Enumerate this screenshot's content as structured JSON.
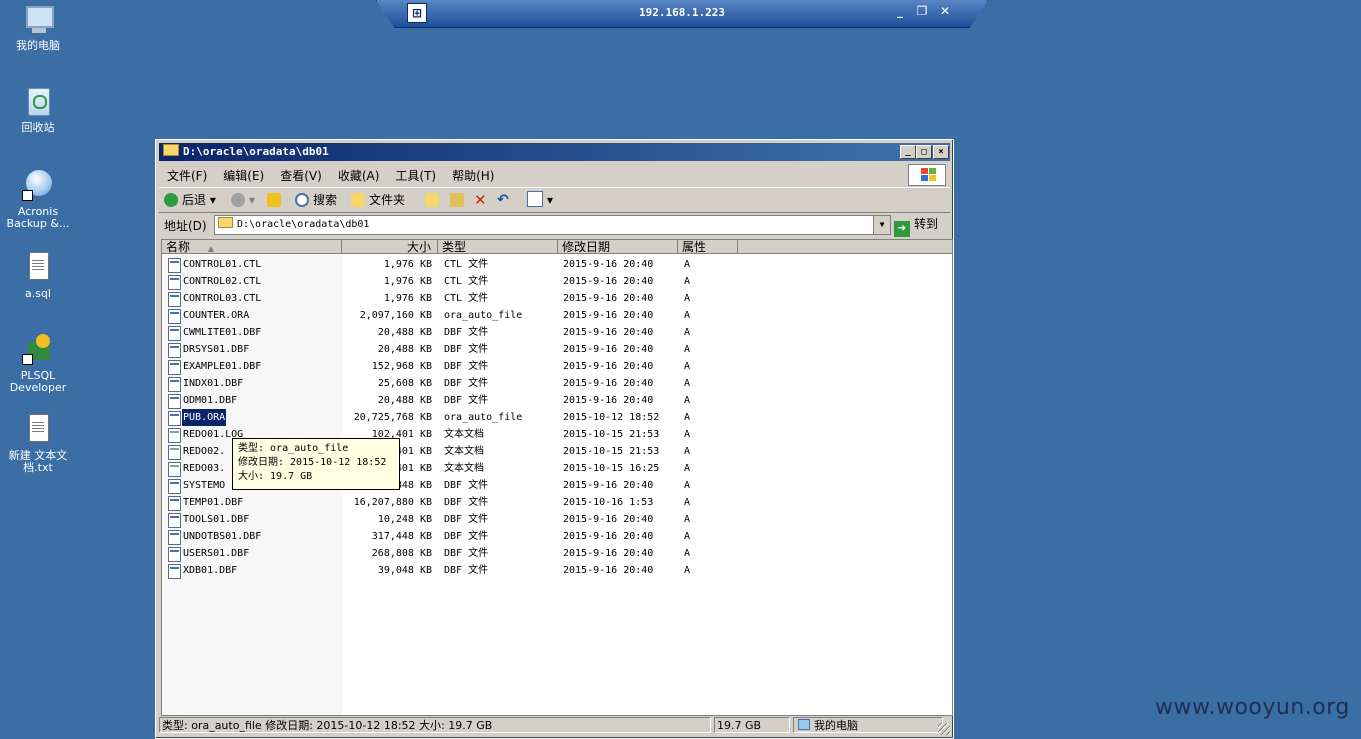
{
  "rdp": {
    "title": "192.168.1.223",
    "pin": "⊞",
    "min": "_",
    "restore": "❐",
    "close": "✕"
  },
  "desktop_icons": [
    {
      "label": "我的电脑"
    },
    {
      "label": "回收站"
    },
    {
      "label": "Acronis Backup &..."
    },
    {
      "label": "a.sql"
    },
    {
      "label": "PLSQL Developer"
    },
    {
      "label": "新建 文本文档.txt"
    }
  ],
  "window": {
    "title": "D:\\oracle\\oradata\\db01",
    "menu": [
      "文件(F)",
      "编辑(E)",
      "查看(V)",
      "收藏(A)",
      "工具(T)",
      "帮助(H)"
    ],
    "toolbar": {
      "back": "后退",
      "search": "搜索",
      "folders": "文件夹"
    },
    "address_label": "地址(D)",
    "address_value": "D:\\oracle\\oradata\\db01",
    "go_label": "转到",
    "columns": {
      "name": "名称",
      "size": "大小",
      "type": "类型",
      "date": "修改日期",
      "attr": "属性"
    },
    "files": [
      {
        "name": "CONTROL01.CTL",
        "size": "1,976 KB",
        "type": "CTL 文件",
        "date": "2015-9-16 20:40",
        "attr": "A"
      },
      {
        "name": "CONTROL02.CTL",
        "size": "1,976 KB",
        "type": "CTL 文件",
        "date": "2015-9-16 20:40",
        "attr": "A"
      },
      {
        "name": "CONTROL03.CTL",
        "size": "1,976 KB",
        "type": "CTL 文件",
        "date": "2015-9-16 20:40",
        "attr": "A"
      },
      {
        "name": "COUNTER.ORA",
        "size": "2,097,160 KB",
        "type": "ora_auto_file",
        "date": "2015-9-16 20:40",
        "attr": "A"
      },
      {
        "name": "CWMLITE01.DBF",
        "size": "20,488 KB",
        "type": "DBF 文件",
        "date": "2015-9-16 20:40",
        "attr": "A"
      },
      {
        "name": "DRSYS01.DBF",
        "size": "20,488 KB",
        "type": "DBF 文件",
        "date": "2015-9-16 20:40",
        "attr": "A"
      },
      {
        "name": "EXAMPLE01.DBF",
        "size": "152,968 KB",
        "type": "DBF 文件",
        "date": "2015-9-16 20:40",
        "attr": "A"
      },
      {
        "name": "INDX01.DBF",
        "size": "25,608 KB",
        "type": "DBF 文件",
        "date": "2015-9-16 20:40",
        "attr": "A"
      },
      {
        "name": "ODM01.DBF",
        "size": "20,488 KB",
        "type": "DBF 文件",
        "date": "2015-9-16 20:40",
        "attr": "A"
      },
      {
        "name": "PUB.ORA",
        "size": "20,725,768 KB",
        "type": "ora_auto_file",
        "date": "2015-10-12 18:52",
        "attr": "A",
        "selected": true
      },
      {
        "name": "REDO01.LOG",
        "size": "102,401 KB",
        "type": "文本文档",
        "date": "2015-10-15 21:53",
        "attr": "A",
        "txt": true
      },
      {
        "name": "REDO02.",
        "size": "401 KB",
        "type": "文本文档",
        "date": "2015-10-15 21:53",
        "attr": "A",
        "txt": true
      },
      {
        "name": "REDO03.",
        "size": "401 KB",
        "type": "文本文档",
        "date": "2015-10-15 16:25",
        "attr": "A",
        "txt": true
      },
      {
        "name": "SYSTEMO",
        "size": "848 KB",
        "type": "DBF 文件",
        "date": "2015-9-16 20:40",
        "attr": "A"
      },
      {
        "name": "TEMP01.DBF",
        "size": "16,207,880 KB",
        "type": "DBF 文件",
        "date": "2015-10-16 1:53",
        "attr": "A"
      },
      {
        "name": "TOOLS01.DBF",
        "size": "10,248 KB",
        "type": "DBF 文件",
        "date": "2015-9-16 20:40",
        "attr": "A"
      },
      {
        "name": "UNDOTBS01.DBF",
        "size": "317,448 KB",
        "type": "DBF 文件",
        "date": "2015-9-16 20:40",
        "attr": "A"
      },
      {
        "name": "USERS01.DBF",
        "size": "268,808 KB",
        "type": "DBF 文件",
        "date": "2015-9-16 20:40",
        "attr": "A"
      },
      {
        "name": "XDB01.DBF",
        "size": "39,048 KB",
        "type": "DBF 文件",
        "date": "2015-9-16 20:40",
        "attr": "A"
      }
    ],
    "tooltip": [
      "类型: ora_auto_file",
      "修改日期: 2015-10-12 18:52",
      "大小: 19.7 GB"
    ],
    "status": {
      "info": "类型: ora_auto_file 修改日期: 2015-10-12 18:52 大小: 19.7 GB",
      "size": "19.7 GB",
      "location": "我的电脑"
    }
  },
  "watermark": "www.wooyun.org",
  "colors": {
    "desktop": "#3a6ea5",
    "title_active": "#0a246a",
    "selection": "#0a246a",
    "tooltip_bg": "#ffffe1"
  }
}
